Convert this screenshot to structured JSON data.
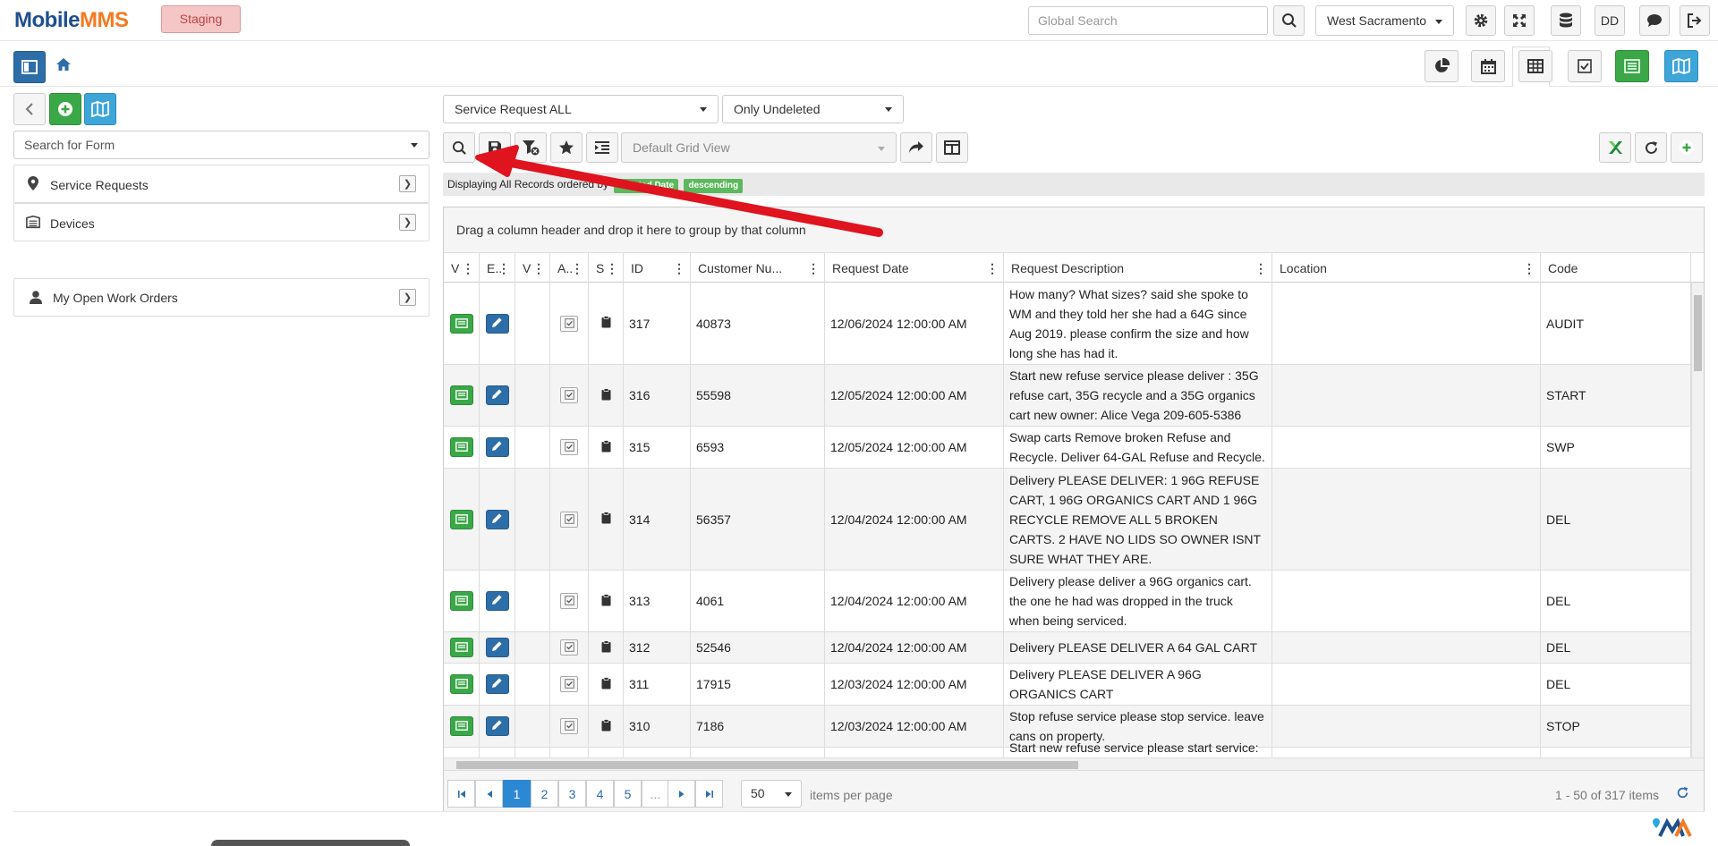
{
  "app": {
    "logo_part1": "Mobile",
    "logo_part2": "MMS",
    "environment": "Staging",
    "global_search_placeholder": "Global Search",
    "location": "West Sacramento",
    "user_initials": "DD"
  },
  "sidebar": {
    "search_placeholder": "Search for Form",
    "items": [
      {
        "label": "Service Requests",
        "icon": "map-pin-icon"
      },
      {
        "label": "Devices",
        "icon": "truck-icon"
      },
      {
        "label": "My Open Work Orders",
        "icon": "user-icon"
      }
    ]
  },
  "toolbar": {
    "form_select": "Service Request ALL",
    "deleted_filter": "Only Undeleted",
    "grid_view": "Default Grid View"
  },
  "status": {
    "displaying_text": "Displaying All Records ordered by",
    "order_field": "Created Date",
    "order_dir": "descending"
  },
  "grid": {
    "group_hint": "Drag a column header and drop it here to group by that column",
    "columns": [
      "V",
      "E..",
      "V",
      "A..",
      "S",
      "ID",
      "Customer Nu...",
      "Request Date",
      "Request Description",
      "Location",
      "Code"
    ],
    "rows": [
      {
        "id": "317",
        "customer": "40873",
        "date": "12/06/2024 12:00:00 AM",
        "desc": "How many? What sizes? said she spoke to WM and they told her she had a 64G since Aug 2019. please confirm the size and how long she has had it.",
        "location": "",
        "code": "AUDIT"
      },
      {
        "id": "316",
        "customer": "55598",
        "date": "12/05/2024 12:00:00 AM",
        "desc": "Start new refuse service please deliver : 35G refuse cart, 35G recycle and a 35G organics cart new owner: Alice Vega 209-605-5386",
        "location": "",
        "code": "START"
      },
      {
        "id": "315",
        "customer": "6593",
        "date": "12/05/2024 12:00:00 AM",
        "desc": "Swap carts Remove broken Refuse and Recycle. Deliver 64-GAL Refuse and Recycle.",
        "location": "",
        "code": "SWP"
      },
      {
        "id": "314",
        "customer": "56357",
        "date": "12/04/2024 12:00:00 AM",
        "desc": "Delivery PLEASE DELIVER: 1 96G REFUSE CART, 1 96G ORGANICS CART AND 1 96G RECYCLE REMOVE ALL 5 BROKEN CARTS. 2 HAVE NO LIDS SO OWNER ISNT SURE WHAT THEY ARE.",
        "location": "",
        "code": "DEL"
      },
      {
        "id": "313",
        "customer": "4061",
        "date": "12/04/2024 12:00:00 AM",
        "desc": "Delivery please deliver a 96G organics cart. the one he had was dropped in the truck when being serviced.",
        "location": "",
        "code": "DEL"
      },
      {
        "id": "312",
        "customer": "52546",
        "date": "12/04/2024 12:00:00 AM",
        "desc": "Delivery PLEASE DELIVER A 64 GAL CART",
        "location": "",
        "code": "DEL"
      },
      {
        "id": "311",
        "customer": "17915",
        "date": "12/03/2024 12:00:00 AM",
        "desc": "Delivery PLEASE DELIVER A 96G ORGANICS CART",
        "location": "",
        "code": "DEL"
      },
      {
        "id": "310",
        "customer": "7186",
        "date": "12/03/2024 12:00:00 AM",
        "desc": "Stop refuse service please stop service. leave cans on property.",
        "location": "",
        "code": "STOP"
      },
      {
        "id": "",
        "customer": "",
        "date": "",
        "desc": "Start new refuse service please start service:",
        "location": "",
        "code": ""
      }
    ]
  },
  "pager": {
    "pages": [
      "1",
      "2",
      "3",
      "4",
      "5",
      "..."
    ],
    "page_size": "50",
    "items_per_page": "items per page",
    "info": "1 - 50 of 317 items"
  },
  "colors": {
    "primary_blue": "#2d6ea8",
    "green": "#3aa847",
    "light_blue": "#3ea5d8",
    "annotation_red": "#e0141e"
  }
}
